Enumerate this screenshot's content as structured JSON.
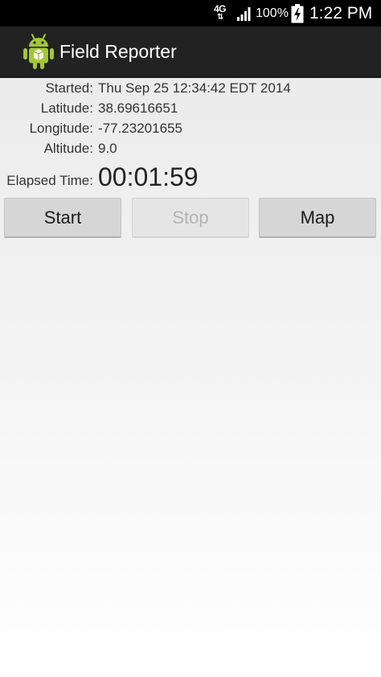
{
  "status_bar": {
    "network": "4G",
    "network_arrows": "⇅",
    "battery_percent": "100%",
    "clock": "1:22 PM"
  },
  "action_bar": {
    "app_icon": "android-robot-icon",
    "title": "Field Reporter"
  },
  "info": {
    "started_label": "Started:",
    "started_value": "Thu Sep 25 12:34:42 EDT 2014",
    "latitude_label": "Latitude:",
    "latitude_value": "38.69616651",
    "longitude_label": "Longitude:",
    "longitude_value": "-77.23201655",
    "altitude_label": "Altitude:",
    "altitude_value": "9.0",
    "elapsed_label": "Elapsed Time:",
    "elapsed_value": "00:01:59"
  },
  "buttons": {
    "start_label": "Start",
    "stop_label": "Stop",
    "map_label": "Map"
  },
  "colors": {
    "status_bar_bg": "#000000",
    "action_bar_bg": "#222222",
    "android_green": "#a4c639",
    "button_bg": "#d6d6d6",
    "button_disabled_text": "#b4b4b4"
  }
}
